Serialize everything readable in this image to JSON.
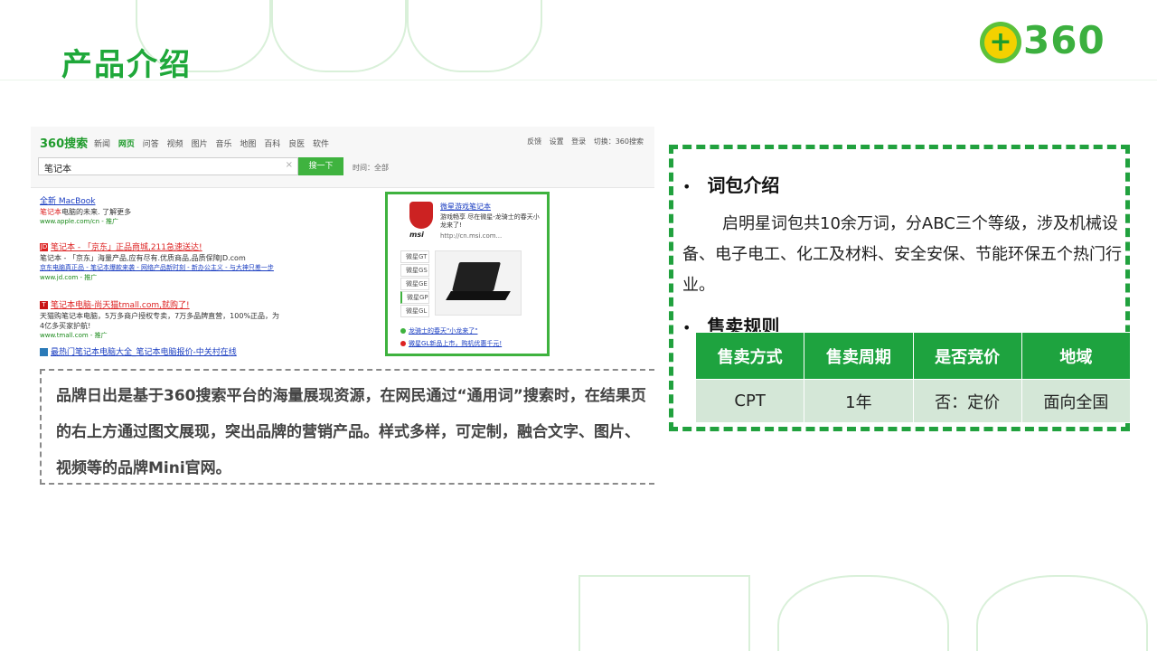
{
  "slide": {
    "title": "产品介绍"
  },
  "logo": {
    "text": "360",
    "plus": "+"
  },
  "screenshot": {
    "logo": "360搜索",
    "nav": [
      "新闻",
      "网页",
      "问答",
      "视频",
      "图片",
      "音乐",
      "地图",
      "百科",
      "良医",
      "软件"
    ],
    "nav_active": "网页",
    "right_links": [
      "反馈",
      "设置",
      "登录",
      "切换：360搜索"
    ],
    "query": "笔记本",
    "clear": "×",
    "search_button": "搜一下",
    "time_filter": "时间：全部",
    "results": [
      {
        "title": "全新 MacBook",
        "desc": "笔记本电脑的未来. 了解更多",
        "url": "www.apple.com/cn - 推广"
      },
      {
        "title": "笔记本 - 「京东」正品商城,211急速送达!",
        "badge": "JD",
        "desc": "笔记本 - 「京东」海量产品,应有尽有.优质商品,品质保障JD.com",
        "url": "京东电脑真正品 - 笔记本爆款来袭 - 网络产品新时刻 - 新办公主义 - 与大神只差一步",
        "url2": "www.jd.com - 推广"
      },
      {
        "title": "笔记本电脑-尚天猫tmall.com,就购了!",
        "badge": "T",
        "desc": "天猫购笔记本电脑，5万多商户授权专卖，7万多品牌直营，100%正品，为4亿多买家护航!",
        "url": "www.tmall.com - 推广"
      },
      {
        "title": "最热门笔记本电脑大全_笔记本电脑报价-中关村在线"
      }
    ],
    "ad": {
      "brand": "msi",
      "title": "微星游戏笔记本",
      "desc": "游戏畅享 尽在微星-龙骑士的春天小龙来了!",
      "url": "http://cn.msi.com...",
      "tabs": [
        "微星GT",
        "微星GS",
        "微星GE",
        "微星GP",
        "微星GL"
      ],
      "links": [
        "龙骑士的春天\"小龙来了\"",
        "微星GL新品上市，购机优惠千元!"
      ]
    }
  },
  "description": "品牌日出是基于360搜索平台的海量展现资源，在网民通过“通用词”搜索时，在结果页的右上方通过图文展现，突出品牌的营销产品。样式多样，可定制，融合文字、图片、视频等的品牌Mini官网。",
  "panel": {
    "bullet_char": "•",
    "section1_title": "词包介绍",
    "section1_body": "启明星词包共10余万词，分ABC三个等级，涉及机械设备、电子电工、化工及材料、安全安保、节能环保五个热门行业。",
    "section2_title": "售卖规则",
    "table": {
      "headers": [
        "售卖方式",
        "售卖周期",
        "是否竞价",
        "地域"
      ],
      "row": [
        "CPT",
        "1年",
        "否：定价",
        "面向全国"
      ]
    }
  }
}
